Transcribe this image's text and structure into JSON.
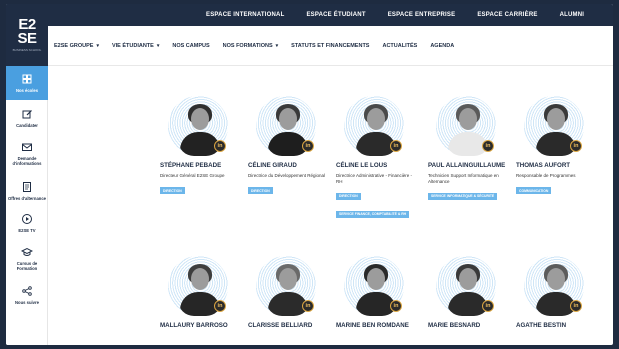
{
  "logo": {
    "mark_line1": "E2",
    "mark_line2": "SE",
    "subtitle": "BUSINESS SCHOOL"
  },
  "topbar": {
    "links": [
      "ESPACE INTERNATIONAL",
      "ESPACE ÉTUDIANT",
      "ESPACE ENTREPRISE",
      "ESPACE CARRIÈRE",
      "ALUMNI"
    ]
  },
  "nav": {
    "items": [
      {
        "label": "E2SE GROUPE",
        "dropdown": true
      },
      {
        "label": "VIE ÉTUDIANTE",
        "dropdown": true
      },
      {
        "label": "NOS CAMPUS",
        "dropdown": false
      },
      {
        "label": "NOS FORMATIONS",
        "dropdown": true
      },
      {
        "label": "STATUTS ET FINANCEMENTS",
        "dropdown": false
      },
      {
        "label": "ACTUALITÉS",
        "dropdown": false
      },
      {
        "label": "AGENDA",
        "dropdown": false
      }
    ],
    "chevron": "▾"
  },
  "sidebar": {
    "items": [
      {
        "label": "Nos écoles",
        "icon": "grid-icon",
        "active": true
      },
      {
        "label": "Candidater",
        "icon": "edit-icon",
        "active": false
      },
      {
        "label": "Demande d'informations",
        "icon": "mail-icon",
        "active": false
      },
      {
        "label": "Offres d'alternance",
        "icon": "document-icon",
        "active": false
      },
      {
        "label": "E2SE TV",
        "icon": "play-icon",
        "active": false
      },
      {
        "label": "Cursus de Formation",
        "icon": "graduation-cap-icon",
        "active": false
      },
      {
        "label": "Nous suivre",
        "icon": "share-icon",
        "active": false
      }
    ]
  },
  "linkedin_label": "in",
  "team": [
    {
      "name": "STÉPHANE PEBADE",
      "role": "Directeur Général E2SE Groupe",
      "badge": "DIRECTION",
      "hair": "#2f2f2f",
      "body": "#222222"
    },
    {
      "name": "CÉLINE GIRAUD",
      "role": "Directrice du Développement Régional",
      "badge": "DIRECTION",
      "hair": "#3a3a3a",
      "body": "#1e1e1e"
    },
    {
      "name": "CÉLINE LE LOUS",
      "role": "Directrice Administrative - Financière - RH",
      "badge": "DIRECTION",
      "badge2": "SERVICE FINANCE, COMPTABILITÉ & RH",
      "hair": "#4a4a4a",
      "body": "#2a2a2a"
    },
    {
      "name": "PAUL ALLAINGUILLAUME",
      "role": "Technicien Support Informatique en Alternance",
      "badge": "SERVICE INFORMATIQUE & SÉCURITÉ",
      "hair": "#5a5a5a",
      "body": "#e8e8e8"
    },
    {
      "name": "THOMAS AUFORT",
      "role": "Responsable de Programmes",
      "badge": "COMMUNICATION",
      "hair": "#3a3a3a",
      "body": "#2a2a2a"
    },
    {
      "name": "MALLAURY BARROSO",
      "role": "",
      "badge": "",
      "hair": "#3e3e3e",
      "body": "#262626"
    },
    {
      "name": "CLARISSE BELLIARD",
      "role": "",
      "badge": "",
      "hair": "#6a6a6a",
      "body": "#2b2b2b"
    },
    {
      "name": "MARINE BEN ROMDANE",
      "role": "",
      "badge": "",
      "hair": "#2a2a2a",
      "body": "#262626"
    },
    {
      "name": "MARIE BESNARD",
      "role": "",
      "badge": "",
      "hair": "#3a3a3a",
      "body": "#2a2a2a"
    },
    {
      "name": "AGATHE BESTIN",
      "role": "",
      "badge": "",
      "hair": "#5c5c5c",
      "body": "#2a2a2a"
    }
  ]
}
